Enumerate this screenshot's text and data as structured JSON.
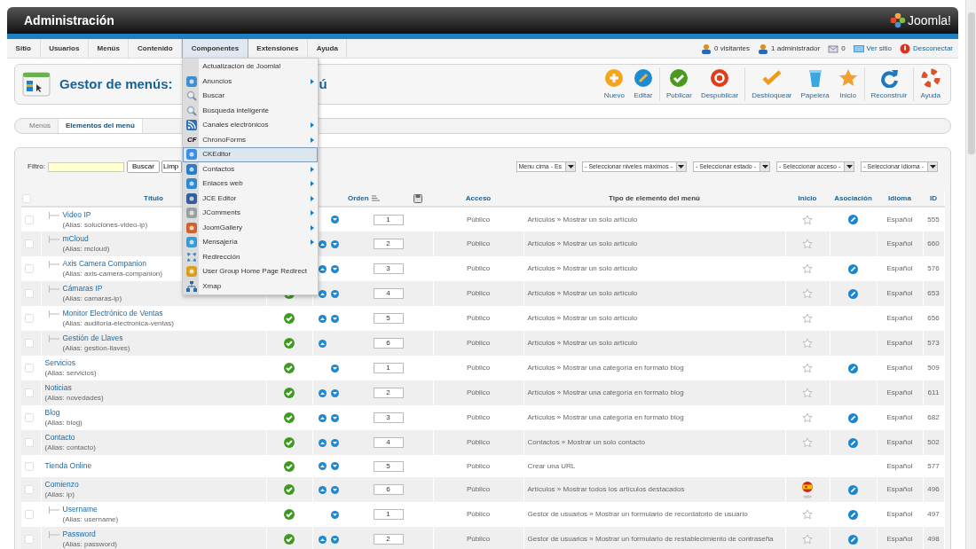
{
  "header": {
    "title": "Administración",
    "logo": "Joomla!"
  },
  "menu": [
    {
      "label": "Sitio",
      "selected": false
    },
    {
      "label": "Usuarios",
      "selected": false
    },
    {
      "label": "Menús",
      "selected": false
    },
    {
      "label": "Contenido",
      "selected": false
    },
    {
      "label": "Componentes",
      "selected": true
    },
    {
      "label": "Extensiones",
      "selected": false
    },
    {
      "label": "Ayuda",
      "selected": false
    }
  ],
  "status": [
    {
      "kind": "visitors",
      "label": "0 visitantes"
    },
    {
      "kind": "admins",
      "label": "1 administrador"
    },
    {
      "kind": "messages",
      "label": "0"
    },
    {
      "kind": "site",
      "label": "Ver sitio"
    },
    {
      "kind": "logout",
      "label": "Desconectar"
    }
  ],
  "page_title": {
    "text": "Gestor de menús:",
    "tail": "ú"
  },
  "toolbar": [
    {
      "label": "Nuevo",
      "kind": "new"
    },
    {
      "label": "Editar",
      "kind": "edit"
    },
    {
      "kind": "separator"
    },
    {
      "label": "Publicar",
      "kind": "publish"
    },
    {
      "label": "Despublicar",
      "kind": "unpublish"
    },
    {
      "kind": "separator"
    },
    {
      "label": "Desbloquear",
      "kind": "checkin"
    },
    {
      "label": "Papelera",
      "kind": "trash"
    },
    {
      "label": "Inicio",
      "kind": "home"
    },
    {
      "kind": "separator"
    },
    {
      "label": "Reconstruir",
      "kind": "rebuild"
    },
    {
      "kind": "separator"
    },
    {
      "label": "Ayuda",
      "kind": "help"
    }
  ],
  "subtabs": [
    {
      "label": "Menús",
      "selected": false
    },
    {
      "label": "Elementos del menú",
      "selected": true
    }
  ],
  "filter": {
    "label": "Filtro:",
    "buttons": [
      "Buscar",
      "Limp"
    ],
    "selects": [
      "Menu cima - Es",
      "- Seleccionar niveles máximos -",
      "- Seleccionar estado -",
      "- Seleccionar acceso -",
      "- Seleccionar idioma -"
    ]
  },
  "dropdown": [
    {
      "label": "Actualización de Joomla!",
      "kind": "plain",
      "submenu": false,
      "selected": false
    },
    {
      "label": "Anuncios",
      "kind": "banners",
      "submenu": true,
      "selected": false
    },
    {
      "label": "Buscar",
      "kind": "search",
      "submenu": false,
      "selected": false
    },
    {
      "label": "Búsqueda inteligente",
      "kind": "search",
      "submenu": false,
      "selected": false
    },
    {
      "label": "Canales electrónicos",
      "kind": "feeds",
      "submenu": true,
      "selected": false
    },
    {
      "label": "ChronoForms",
      "kind": "lettered",
      "icon_text": "CF",
      "submenu": true,
      "selected": false
    },
    {
      "label": "CKEditor",
      "kind": "editor",
      "submenu": false,
      "selected": true
    },
    {
      "label": "Contactos",
      "kind": "contacts",
      "submenu": true,
      "selected": false
    },
    {
      "label": "Enlaces web",
      "kind": "weblinks",
      "submenu": true,
      "selected": false
    },
    {
      "label": "JCE Editor",
      "kind": "jce",
      "submenu": true,
      "selected": false
    },
    {
      "label": "JComments",
      "kind": "comments",
      "submenu": true,
      "selected": false
    },
    {
      "label": "JoomGallery",
      "kind": "gallery",
      "submenu": true,
      "selected": false
    },
    {
      "label": "Mensajería",
      "kind": "messages",
      "submenu": true,
      "selected": false
    },
    {
      "label": "Redirección",
      "kind": "redirect",
      "submenu": false,
      "selected": false
    },
    {
      "label": "User Group Home Page Redirect",
      "kind": "usergroup",
      "submenu": false,
      "selected": false
    },
    {
      "label": "Xmap",
      "kind": "sitemap",
      "submenu": false,
      "selected": false
    }
  ],
  "table": {
    "select_all_checked": false,
    "columns": [
      {
        "label": "Título",
        "link": true
      },
      {
        "label": "Orden",
        "link": true
      },
      {
        "label": "Acceso",
        "link": true
      },
      {
        "label": "Tipo de elemento del menú",
        "link": false
      },
      {
        "label": "Inicio",
        "link": true
      },
      {
        "label": "Asociación",
        "link": true
      },
      {
        "label": "Idioma",
        "link": true
      },
      {
        "label": "ID",
        "link": true
      }
    ],
    "rows": [
      {
        "checked": false,
        "title": "Video IP",
        "alias": "(Alias: soluciones-video-ip)",
        "branch": true,
        "order_up": false,
        "order_down": true,
        "order": "1",
        "access": "Público",
        "type": "Artículos » Mostrar un solo artículo",
        "home": false,
        "association": true,
        "language": "Español",
        "id": "555"
      },
      {
        "checked": false,
        "title": "mCloud",
        "alias": "(Alias: mcloud)",
        "branch": true,
        "order_up": true,
        "order_down": true,
        "order": "2",
        "access": "Público",
        "type": "Artículos » Mostrar un solo artículo",
        "home": false,
        "association": false,
        "language": "Español",
        "id": "660"
      },
      {
        "checked": false,
        "title": "Axis Camera Companion",
        "alias": "(Alias: axis-camera-companion)",
        "branch": true,
        "order_up": true,
        "order_down": true,
        "order": "3",
        "access": "Público",
        "type": "Artículos » Mostrar un solo artículo",
        "home": false,
        "association": true,
        "language": "Español",
        "id": "576"
      },
      {
        "checked": false,
        "title": "Cámaras IP",
        "alias": "(Alias: camaras-ip)",
        "branch": true,
        "published": true,
        "order_up": true,
        "order_down": true,
        "order": "4",
        "access": "Público",
        "type": "Artículos » Mostrar un solo artículo",
        "home": false,
        "association": true,
        "language": "Español",
        "id": "653"
      },
      {
        "checked": false,
        "title": "Monitor Electrónico de Ventas",
        "alias": "(Alias: auditoria-electronica-ventas)",
        "branch": true,
        "published": true,
        "order_up": true,
        "order_down": true,
        "order": "5",
        "access": "Público",
        "type": "Artículos » Mostrar un solo artículo",
        "home": false,
        "association": false,
        "language": "Español",
        "id": "656"
      },
      {
        "checked": false,
        "title": "Gestión de Llaves",
        "alias": "(Alias: gestion-llaves)",
        "branch": true,
        "published": true,
        "order_up": true,
        "order_down": false,
        "order": "6",
        "access": "Público",
        "type": "Artículos » Mostrar un solo artículo",
        "home": false,
        "association": false,
        "language": "Español",
        "id": "573"
      },
      {
        "checked": false,
        "title": "Servicios",
        "alias": "(Alias: servicios)",
        "branch": false,
        "published": true,
        "order_up": false,
        "order_down": true,
        "order": "1",
        "access": "Público",
        "type": "Artículos » Mostrar una categoría en formato blog",
        "home": false,
        "association": true,
        "language": "Español",
        "id": "509"
      },
      {
        "checked": false,
        "title": "Noticias",
        "alias": "(Alias: novedades)",
        "branch": false,
        "published": true,
        "order_up": true,
        "order_down": true,
        "order": "2",
        "access": "Público",
        "type": "Artículos » Mostrar una categoría en formato blog",
        "home": false,
        "association": false,
        "language": "Español",
        "id": "611"
      },
      {
        "checked": false,
        "title": "Blog",
        "alias": "(Alias: blog)",
        "branch": false,
        "published": true,
        "order_up": true,
        "order_down": true,
        "order": "3",
        "access": "Público",
        "type": "Artículos » Mostrar una categoría en formato blog",
        "home": false,
        "association": true,
        "language": "Español",
        "id": "682"
      },
      {
        "checked": false,
        "title": "Contacto",
        "alias": "(Alias: contacto)",
        "branch": false,
        "published": true,
        "order_up": true,
        "order_down": true,
        "order": "4",
        "access": "Público",
        "type": "Contactos » Mostrar un solo contacto",
        "home": false,
        "association": true,
        "language": "Español",
        "id": "502"
      },
      {
        "checked": false,
        "title": "Tienda Online",
        "branch": false,
        "published": true,
        "order_up": true,
        "order_down": true,
        "order": "5",
        "access": "Público",
        "type": "Crear una URL",
        "association": false,
        "language": "Español",
        "id": "577"
      },
      {
        "checked": false,
        "title": "Comienzo",
        "alias": "(Alias: ip)",
        "branch": false,
        "published": true,
        "order_up": true,
        "order_down": true,
        "order": "6",
        "access": "Público",
        "type": "Artículos » Mostrar todos los artículos destacados",
        "home": true,
        "association": true,
        "language": "Español",
        "id": "496"
      },
      {
        "checked": false,
        "title": "Username",
        "alias": "(Alias: username)",
        "branch": true,
        "published": true,
        "order_up": false,
        "order_down": true,
        "order": "1",
        "access": "Público",
        "type": "Gestor de usuarios » Mostrar un formulario de recordatorio de usuario",
        "home": false,
        "association": true,
        "language": "Español",
        "id": "497"
      },
      {
        "checked": false,
        "title": "Password",
        "alias": "(Alias: password)",
        "branch": true,
        "published": true,
        "order_up": true,
        "order_down": true,
        "order": "2",
        "access": "Público",
        "type": "Gestor de usuarios » Mostrar un formulario de restablecimiento de contraseña",
        "home": false,
        "association": true,
        "language": "Español",
        "id": "498"
      }
    ]
  }
}
